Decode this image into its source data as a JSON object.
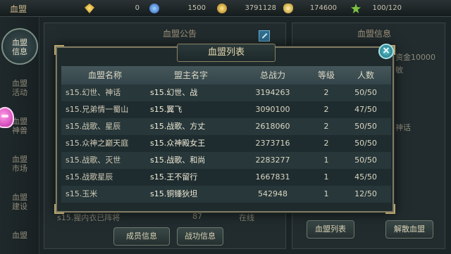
{
  "topbar": {
    "title": "血盟",
    "resources": [
      {
        "icon": "diamond-icon",
        "value": "0"
      },
      {
        "icon": "crystal-icon",
        "value": "1500"
      },
      {
        "icon": "gold-coin-icon",
        "value": "3791128"
      },
      {
        "icon": "gold-ingot-icon",
        "value": "174600"
      },
      {
        "icon": "energy-icon",
        "value": "100/120"
      }
    ]
  },
  "sidebar": {
    "items": [
      {
        "label": "血盟信息"
      },
      {
        "label": "血盟活动"
      },
      {
        "label": "血盟神兽"
      },
      {
        "label": "血盟市场"
      },
      {
        "label": "血盟建设"
      },
      {
        "label": "血盟"
      }
    ]
  },
  "background": {
    "announcement_title": "血盟公告",
    "info_title": "血盟信息",
    "fund_text": "资金10000",
    "partial_text_1": "敏",
    "partial_text_2": "神话",
    "member_row_partial": "s15.猩内衣已阵将",
    "member_row_level": "87",
    "member_row_status": "在线",
    "member_info_button": "成员信息",
    "contribution_button": "战功信息",
    "clan_list_button": "血盟列表",
    "disband_button": "解散血盟"
  },
  "dialog": {
    "title": "血盟列表",
    "close_label": "×",
    "columns": [
      "血盟名称",
      "盟主名字",
      "总战力",
      "等级",
      "人数"
    ],
    "rows": [
      {
        "name": "s15.幻世、神话",
        "leader": "s15.幻世、战",
        "power": "3194263",
        "level": "2",
        "members": "50/50"
      },
      {
        "name": "s15.兄弟情一蜀山",
        "leader": "s15.翼飞",
        "power": "3090100",
        "level": "2",
        "members": "47/50"
      },
      {
        "name": "s15.战歌、星辰",
        "leader": "s15.战歌、方丈",
        "power": "2618060",
        "level": "2",
        "members": "50/50"
      },
      {
        "name": "s15.众神之巅天庭",
        "leader": "s15.众神殿女王",
        "power": "2373716",
        "level": "2",
        "members": "50/50"
      },
      {
        "name": "s15.战歌、灭世",
        "leader": "s15.战歌、和尚",
        "power": "2283277",
        "level": "1",
        "members": "50/50"
      },
      {
        "name": "s15.战歌星辰",
        "leader": "s15.王不留行",
        "power": "1667831",
        "level": "1",
        "members": "45/50"
      },
      {
        "name": "s15.玉米",
        "leader": "s15.铜锤狄坦",
        "power": "542948",
        "level": "1",
        "members": "12/50"
      }
    ]
  }
}
